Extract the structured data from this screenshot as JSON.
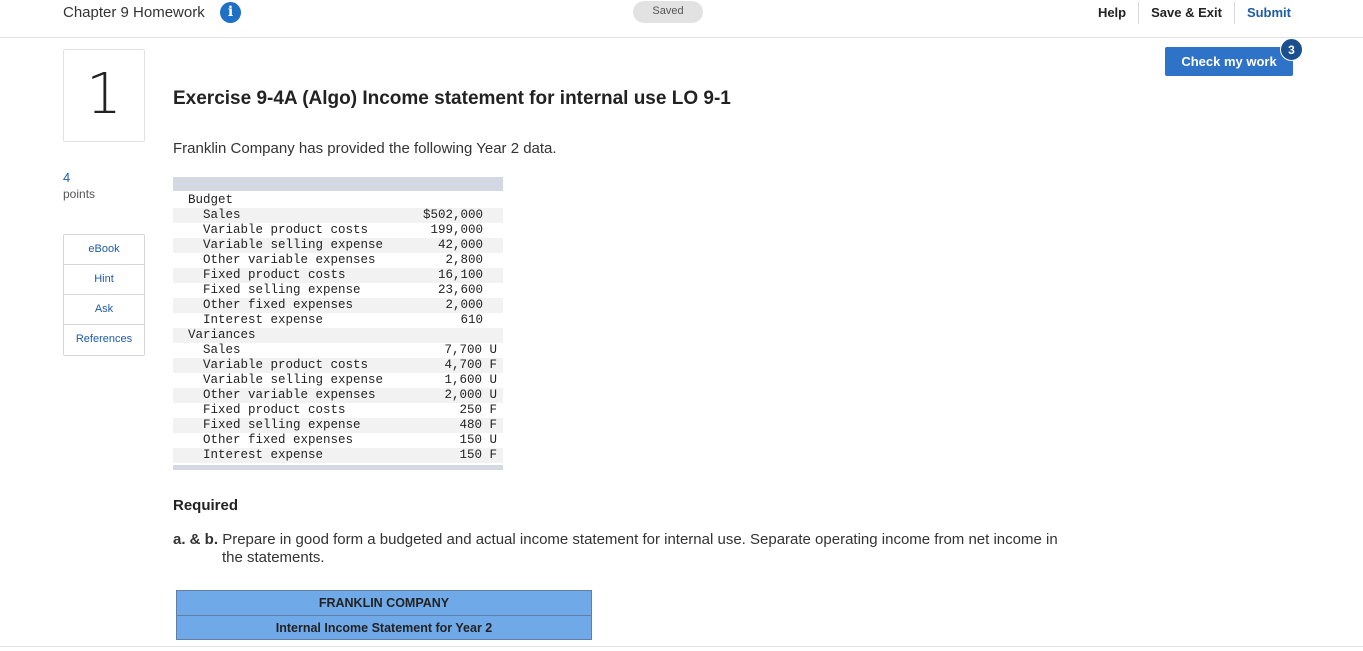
{
  "header": {
    "assignment_title": "Chapter 9 Homework",
    "saved_label": "Saved",
    "links": {
      "help": "Help",
      "save_exit": "Save & Exit",
      "submit": "Submit"
    }
  },
  "question": {
    "number": "1",
    "points_value": "4",
    "points_label": "points",
    "title": "Exercise 9-4A (Algo) Income statement for internal use LO 9-1",
    "intro": "Franklin Company has provided the following Year 2 data."
  },
  "side_tabs": [
    "eBook",
    "Hint",
    "Ask",
    "References"
  ],
  "check_work": {
    "label": "Check my work",
    "badge": "3"
  },
  "data_table": {
    "budget_heading": "Budget",
    "budget": [
      {
        "label": "Sales",
        "value": "$502,000"
      },
      {
        "label": "Variable product costs",
        "value": "199,000"
      },
      {
        "label": "Variable selling expense",
        "value": "42,000"
      },
      {
        "label": "Other variable expenses",
        "value": "2,800"
      },
      {
        "label": "Fixed product costs",
        "value": "16,100"
      },
      {
        "label": "Fixed selling expense",
        "value": "23,600"
      },
      {
        "label": "Other fixed expenses",
        "value": "2,000"
      },
      {
        "label": "Interest expense",
        "value": "610"
      }
    ],
    "variances_heading": "Variances",
    "variances": [
      {
        "label": "Sales",
        "value": "7,700 U"
      },
      {
        "label": "Variable product costs",
        "value": "4,700 F"
      },
      {
        "label": "Variable selling expense",
        "value": "1,600 U"
      },
      {
        "label": "Other variable expenses",
        "value": "2,000 U"
      },
      {
        "label": "Fixed product costs",
        "value": "250 F"
      },
      {
        "label": "Fixed selling expense",
        "value": "480 F"
      },
      {
        "label": "Other fixed expenses",
        "value": "150 U"
      },
      {
        "label": "Interest expense",
        "value": "150 F"
      }
    ]
  },
  "required": {
    "heading": "Required",
    "part_label": "a. & b.",
    "text_line1": "Prepare in good form a budgeted and actual income statement for internal use. Separate operating income from net income in",
    "text_line2": "the statements."
  },
  "statement": {
    "company": "FRANKLIN COMPANY",
    "title": "Internal Income Statement for Year 2"
  },
  "colors": {
    "primary_blue": "#2e73c7",
    "badge_blue": "#1c4f8f",
    "statement_header": "#6fa9e8",
    "link_blue": "#1d5ca8"
  },
  "icons": {
    "info": "info-icon"
  }
}
